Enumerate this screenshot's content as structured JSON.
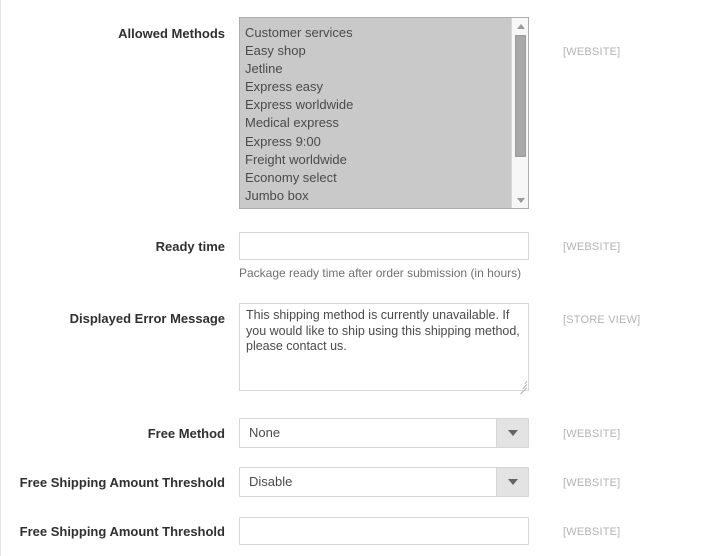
{
  "form": {
    "rows": [
      {
        "key": "allowed_methods",
        "label": "Allowed Methods",
        "type": "multiselect",
        "scope": "[WEBSITE]",
        "options": [
          "Customer services",
          "Easy shop",
          "Jetline",
          "Express easy",
          "Express worldwide",
          "Medical express",
          "Express 9:00",
          "Freight worldwide",
          "Economy select",
          "Jumbo box"
        ]
      },
      {
        "key": "ready_time",
        "label": "Ready time",
        "type": "text",
        "value": "",
        "scope": "[WEBSITE]",
        "hint": "Package ready time after order submission (in hours)"
      },
      {
        "key": "displayed_error_message",
        "label": "Displayed Error Message",
        "type": "textarea",
        "value": "This shipping method is currently unavailable. If you would like to ship using this shipping method, please contact us.",
        "scope": "[STORE VIEW]"
      },
      {
        "key": "free_method",
        "label": "Free Method",
        "type": "select",
        "value": "None",
        "scope": "[WEBSITE]"
      },
      {
        "key": "free_shipping_amount_threshold_enable",
        "label": "Free Shipping Amount Threshold",
        "type": "select",
        "value": "Disable",
        "scope": "[WEBSITE]"
      },
      {
        "key": "free_shipping_amount_threshold_value",
        "label": "Free Shipping Amount Threshold",
        "type": "text",
        "value": "",
        "scope": "[WEBSITE]"
      }
    ]
  },
  "icons": {
    "scroll_up": "scroll-up-arrow-icon",
    "scroll_down": "scroll-down-arrow-icon",
    "dropdown": "chevron-down-icon",
    "resize": "resize-grip-icon"
  },
  "colors": {
    "text": "#303030",
    "muted_text": "#4a4a4a",
    "scope_label": "#b3b3b3",
    "hint": "#707070",
    "border": "#d6d6d6",
    "multiselect_bg": "#c9c9c9",
    "select_button_bg": "#e3e3e3"
  }
}
